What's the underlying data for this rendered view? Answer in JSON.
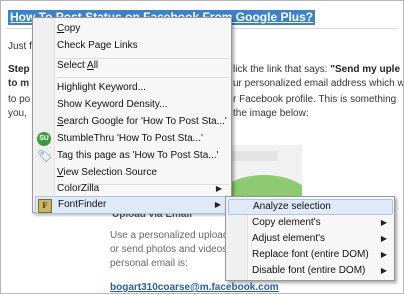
{
  "article": {
    "title": "How To Post Status on Facebook From Google Plus?",
    "line1_start": "Just f",
    "line2_start": "Step",
    "line2_bold_right": "\"Send my uple",
    "line2_right": "lick the link that says: ",
    "line3_start": "to m",
    "line3_right": "ur personalized email address which w",
    "line4_start": "to po",
    "line4_right": "r Facebook profile. This is something",
    "line5_start": "you,",
    "line5_right": "the image below:",
    "heading_partial": "Upload via Email",
    "body1": "Use a personalized upload em",
    "body2": "or send photos and videos st",
    "body3": "personal email is:",
    "bottom_link": "bogart310coarse@m.facebook.com"
  },
  "context_menu": {
    "items": [
      {
        "label": "Copy",
        "underline": "C"
      },
      {
        "label": "Check Page Links",
        "underline": ""
      },
      {
        "label": "Select All",
        "underline": "A"
      },
      {
        "label": "Highlight Keyword...",
        "underline": ""
      },
      {
        "label": "Show Keyword Density...",
        "underline": ""
      },
      {
        "label": "Search Google for 'How To Post Sta...'",
        "underline": "S"
      },
      {
        "label": "StumbleThru 'How To Post Sta...'",
        "underline": ""
      },
      {
        "label": "Tag this page as 'How To Post Sta...'",
        "underline": ""
      },
      {
        "label": "View Selection Source",
        "underline": "V"
      },
      {
        "label": "ColorZilla",
        "underline": ""
      },
      {
        "label": "FontFinder",
        "underline": ""
      }
    ],
    "icons": {
      "stumble": "SU",
      "tag": "tag-icon",
      "fontfinder": "F"
    }
  },
  "submenu": {
    "items": [
      {
        "label": "Analyze selection"
      },
      {
        "label": "Copy element's"
      },
      {
        "label": "Adjust element's"
      },
      {
        "label": "Replace font (entire DOM)"
      },
      {
        "label": "Disable font (entire DOM)"
      }
    ]
  },
  "colors": {
    "selection": "#3b82c8",
    "menu_highlight": "#dfe9f7",
    "link": "#2a5db0"
  }
}
